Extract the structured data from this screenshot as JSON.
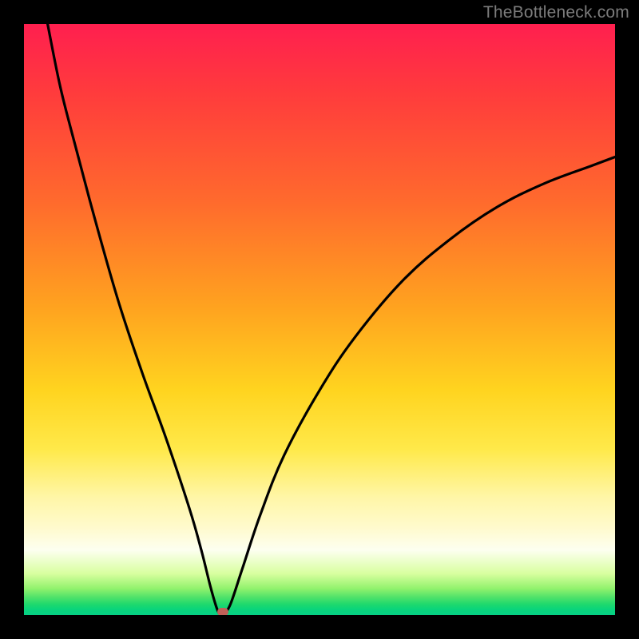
{
  "watermark": "TheBottleneck.com",
  "chart_data": {
    "type": "line",
    "title": "",
    "xlabel": "",
    "ylabel": "",
    "xlim": [
      0,
      100
    ],
    "ylim": [
      0,
      100
    ],
    "grid": false,
    "legend": false,
    "gradient_stops": [
      {
        "pos": 0,
        "color": "#ff1f4f"
      },
      {
        "pos": 30,
        "color": "#ff6a2d"
      },
      {
        "pos": 62,
        "color": "#ffd41f"
      },
      {
        "pos": 85,
        "color": "#fffacb"
      },
      {
        "pos": 100,
        "color": "#06d085"
      }
    ],
    "series": [
      {
        "name": "bottleneck-curve-left",
        "x": [
          4.0,
          6.0,
          8.0,
          12.0,
          16.0,
          20.0,
          24.0,
          28.0,
          30.0,
          31.5,
          32.5,
          33.0
        ],
        "y": [
          100.0,
          90.0,
          82.0,
          67.0,
          53.0,
          41.0,
          30.0,
          18.0,
          11.0,
          5.0,
          1.5,
          0.3
        ]
      },
      {
        "name": "bottleneck-curve-right",
        "x": [
          34.0,
          35.0,
          37.0,
          40.0,
          44.0,
          50.0,
          56.0,
          64.0,
          72.0,
          80.0,
          88.0,
          96.0,
          100.0
        ],
        "y": [
          0.3,
          2.0,
          8.0,
          17.0,
          27.0,
          38.0,
          47.0,
          56.5,
          63.5,
          69.0,
          73.0,
          76.0,
          77.5
        ]
      }
    ],
    "marker": {
      "x": 33.6,
      "y": 0.5,
      "color": "#c06058"
    }
  }
}
